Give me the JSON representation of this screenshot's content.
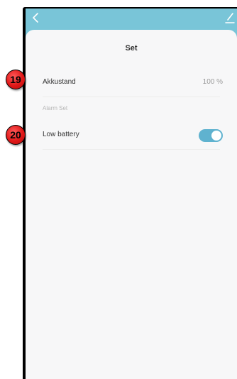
{
  "header": {
    "back_icon": "chevron-left-icon",
    "edit_icon": "edit-pencil-icon",
    "accent": "#79c5d8"
  },
  "page": {
    "title": "Set"
  },
  "settings": {
    "battery_level": {
      "label": "Akkustand",
      "value": "100 %"
    },
    "alarm_section": {
      "label": "Alarm Set"
    },
    "low_battery": {
      "label": "Low battery",
      "enabled": true,
      "toggle_color": "#5fb2cf"
    }
  },
  "annotations": {
    "badge_a": "19",
    "badge_b": "20"
  }
}
